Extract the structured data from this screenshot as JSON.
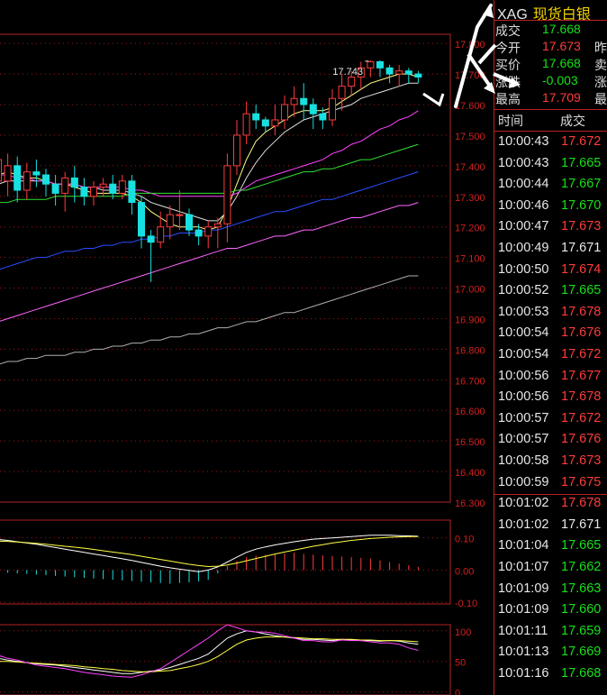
{
  "symbol": {
    "code": "XAG",
    "name": "现货白银"
  },
  "quote": [
    {
      "label": "成交",
      "value": "17.668",
      "color": "green",
      "extra": ""
    },
    {
      "label": "今开",
      "value": "17.673",
      "color": "red",
      "extra": "昨"
    },
    {
      "label": "买价",
      "value": "17.668",
      "color": "green",
      "extra": "卖"
    },
    {
      "label": "涨跌",
      "value": "-0.003",
      "color": "green",
      "extra": "涨"
    },
    {
      "label": "最高",
      "value": "17.709",
      "color": "red",
      "extra": "最"
    }
  ],
  "ticks_header": {
    "time": "时间",
    "price": "成交"
  },
  "ticks": [
    {
      "time": "10:00:43",
      "price": "17.672",
      "color": "red"
    },
    {
      "time": "10:00:43",
      "price": "17.665",
      "color": "green"
    },
    {
      "time": "10:00:44",
      "price": "17.667",
      "color": "green"
    },
    {
      "time": "10:00:46",
      "price": "17.670",
      "color": "green"
    },
    {
      "time": "10:00:47",
      "price": "17.673",
      "color": "red"
    },
    {
      "time": "10:00:49",
      "price": "17.671",
      "color": "white"
    },
    {
      "time": "10:00:50",
      "price": "17.674",
      "color": "red"
    },
    {
      "time": "10:00:52",
      "price": "17.665",
      "color": "green"
    },
    {
      "time": "10:00:53",
      "price": "17.678",
      "color": "red"
    },
    {
      "time": "10:00:54",
      "price": "17.676",
      "color": "red"
    },
    {
      "time": "10:00:54",
      "price": "17.672",
      "color": "red"
    },
    {
      "time": "10:00:56",
      "price": "17.677",
      "color": "red"
    },
    {
      "time": "10:00:56",
      "price": "17.678",
      "color": "red"
    },
    {
      "time": "10:00:57",
      "price": "17.672",
      "color": "red"
    },
    {
      "time": "10:00:57",
      "price": "17.676",
      "color": "red"
    },
    {
      "time": "10:00:58",
      "price": "17.673",
      "color": "red"
    },
    {
      "time": "10:00:59",
      "price": "17.675",
      "color": "red"
    },
    {
      "time": "10:01:02",
      "price": "17.678",
      "color": "red"
    },
    {
      "time": "10:01:02",
      "price": "17.671",
      "color": "white"
    },
    {
      "time": "10:01:04",
      "price": "17.665",
      "color": "green"
    },
    {
      "time": "10:01:07",
      "price": "17.662",
      "color": "green"
    },
    {
      "time": "10:01:09",
      "price": "17.663",
      "color": "green"
    },
    {
      "time": "10:01:09",
      "price": "17.660",
      "color": "green"
    },
    {
      "time": "10:01:11",
      "price": "17.659",
      "color": "green"
    },
    {
      "time": "10:01:13",
      "price": "17.669",
      "color": "green"
    },
    {
      "time": "10:01:16",
      "price": "17.668",
      "color": "green"
    }
  ],
  "colors": {
    "up": "#ff3b3b",
    "down": "#18e0e0",
    "grid": "#a01818",
    "border": "#b22222"
  },
  "chart_data": [
    {
      "type": "candlestick",
      "title": "",
      "ylim": [
        16.3,
        17.83
      ],
      "y_ticks": [
        "16.300",
        "16.400",
        "16.500",
        "16.600",
        "16.700",
        "16.800",
        "16.900",
        "17.000",
        "17.100",
        "17.200",
        "17.300",
        "17.400",
        "17.500",
        "17.600",
        "17.700",
        "17.800"
      ],
      "peak_label": "17.743",
      "candles": [
        [
          17.35,
          17.42,
          17.3,
          17.46
        ],
        [
          17.35,
          17.4,
          17.3,
          17.44
        ],
        [
          17.4,
          17.32,
          17.28,
          17.43
        ],
        [
          17.32,
          17.38,
          17.29,
          17.41
        ],
        [
          17.38,
          17.37,
          17.33,
          17.42
        ],
        [
          17.37,
          17.34,
          17.3,
          17.39
        ],
        [
          17.34,
          17.31,
          17.27,
          17.37
        ],
        [
          17.31,
          17.36,
          17.25,
          17.38
        ],
        [
          17.36,
          17.33,
          17.28,
          17.4
        ],
        [
          17.33,
          17.3,
          17.27,
          17.36
        ],
        [
          17.3,
          17.33,
          17.27,
          17.35
        ],
        [
          17.33,
          17.34,
          17.3,
          17.36
        ],
        [
          17.34,
          17.31,
          17.29,
          17.37
        ],
        [
          17.31,
          17.35,
          17.29,
          17.37
        ],
        [
          17.35,
          17.28,
          17.24,
          17.37
        ],
        [
          17.28,
          17.17,
          17.13,
          17.3
        ],
        [
          17.17,
          17.15,
          17.02,
          17.19
        ],
        [
          17.15,
          17.2,
          17.13,
          17.25
        ],
        [
          17.2,
          17.24,
          17.16,
          17.27
        ],
        [
          17.24,
          17.24,
          17.19,
          17.32
        ],
        [
          17.24,
          17.19,
          17.17,
          17.26
        ],
        [
          17.19,
          17.17,
          17.14,
          17.21
        ],
        [
          17.17,
          17.2,
          17.13,
          17.22
        ],
        [
          17.2,
          17.21,
          17.13,
          17.23
        ],
        [
          17.21,
          17.4,
          17.15,
          17.44
        ],
        [
          17.4,
          17.5,
          17.37,
          17.55
        ],
        [
          17.5,
          17.57,
          17.47,
          17.61
        ],
        [
          17.57,
          17.55,
          17.52,
          17.6
        ],
        [
          17.55,
          17.53,
          17.51,
          17.56
        ],
        [
          17.53,
          17.55,
          17.5,
          17.6
        ],
        [
          17.55,
          17.6,
          17.52,
          17.63
        ],
        [
          17.6,
          17.62,
          17.56,
          17.66
        ],
        [
          17.62,
          17.6,
          17.55,
          17.67
        ],
        [
          17.6,
          17.57,
          17.52,
          17.62
        ],
        [
          17.57,
          17.55,
          17.52,
          17.59
        ],
        [
          17.55,
          17.62,
          17.53,
          17.65
        ],
        [
          17.62,
          17.66,
          17.58,
          17.7
        ],
        [
          17.66,
          17.69,
          17.63,
          17.71
        ],
        [
          17.69,
          17.72,
          17.65,
          17.74
        ],
        [
          17.72,
          17.74,
          17.69,
          17.745
        ],
        [
          17.74,
          17.72,
          17.69,
          17.745
        ],
        [
          17.72,
          17.7,
          17.67,
          17.73
        ],
        [
          17.7,
          17.71,
          17.66,
          17.73
        ],
        [
          17.71,
          17.7,
          17.67,
          17.72
        ],
        [
          17.7,
          17.69,
          17.67,
          17.71
        ]
      ],
      "ma_series": [
        {
          "color": "#ffff88",
          "values": [
            17.37,
            17.38,
            17.37,
            17.36,
            17.36,
            17.35,
            17.34,
            17.34,
            17.33,
            17.32,
            17.31,
            17.31,
            17.31,
            17.31,
            17.3,
            17.28,
            17.25,
            17.23,
            17.21,
            17.2,
            17.2,
            17.2,
            17.19,
            17.2,
            17.26,
            17.34,
            17.42,
            17.48,
            17.51,
            17.53,
            17.55,
            17.57,
            17.58,
            17.58,
            17.58,
            17.59,
            17.61,
            17.63,
            17.65,
            17.67,
            17.68,
            17.69,
            17.7,
            17.7,
            17.69
          ]
        },
        {
          "color": "#e0e0e0",
          "values": [
            17.34,
            17.35,
            17.35,
            17.35,
            17.35,
            17.35,
            17.34,
            17.34,
            17.34,
            17.33,
            17.33,
            17.32,
            17.32,
            17.32,
            17.31,
            17.3,
            17.28,
            17.27,
            17.26,
            17.25,
            17.24,
            17.23,
            17.22,
            17.22,
            17.25,
            17.3,
            17.36,
            17.41,
            17.45,
            17.48,
            17.51,
            17.53,
            17.55,
            17.56,
            17.57,
            17.58,
            17.59,
            17.6,
            17.62,
            17.63,
            17.64,
            17.65,
            17.66,
            17.67,
            17.67
          ]
        },
        {
          "color": "#ff44ff",
          "values": [
            17.37,
            17.37,
            17.36,
            17.36,
            17.35,
            17.35,
            17.34,
            17.34,
            17.34,
            17.33,
            17.33,
            17.33,
            17.33,
            17.33,
            17.32,
            17.32,
            17.31,
            17.3,
            17.3,
            17.3,
            17.3,
            17.3,
            17.3,
            17.3,
            17.3,
            17.31,
            17.33,
            17.35,
            17.36,
            17.37,
            17.38,
            17.39,
            17.4,
            17.41,
            17.42,
            17.44,
            17.45,
            17.47,
            17.48,
            17.5,
            17.52,
            17.53,
            17.55,
            17.56,
            17.58
          ]
        },
        {
          "color": "#30e030",
          "values": [
            17.28,
            17.28,
            17.29,
            17.29,
            17.29,
            17.29,
            17.3,
            17.3,
            17.3,
            17.3,
            17.3,
            17.3,
            17.3,
            17.3,
            17.31,
            17.31,
            17.31,
            17.31,
            17.31,
            17.31,
            17.31,
            17.31,
            17.31,
            17.31,
            17.31,
            17.32,
            17.32,
            17.33,
            17.34,
            17.35,
            17.36,
            17.37,
            17.38,
            17.38,
            17.39,
            17.39,
            17.4,
            17.41,
            17.42,
            17.42,
            17.43,
            17.44,
            17.45,
            17.46,
            17.47
          ]
        },
        {
          "color": "#2a4dff",
          "values": [
            17.06,
            17.07,
            17.08,
            17.09,
            17.1,
            17.1,
            17.11,
            17.12,
            17.12,
            17.13,
            17.13,
            17.14,
            17.14,
            17.15,
            17.15,
            17.16,
            17.16,
            17.17,
            17.17,
            17.18,
            17.18,
            17.18,
            17.19,
            17.19,
            17.2,
            17.21,
            17.22,
            17.23,
            17.24,
            17.25,
            17.25,
            17.26,
            17.27,
            17.28,
            17.29,
            17.29,
            17.3,
            17.31,
            17.32,
            17.33,
            17.34,
            17.35,
            17.36,
            17.37,
            17.38
          ]
        },
        {
          "color": "#ff66ff",
          "values": [
            16.89,
            16.9,
            16.91,
            16.92,
            16.93,
            16.94,
            16.95,
            16.96,
            16.97,
            16.98,
            16.99,
            17.0,
            17.01,
            17.02,
            17.03,
            17.04,
            17.05,
            17.06,
            17.07,
            17.08,
            17.09,
            17.1,
            17.11,
            17.12,
            17.13,
            17.13,
            17.14,
            17.15,
            17.16,
            17.17,
            17.17,
            17.18,
            17.19,
            17.19,
            17.2,
            17.21,
            17.22,
            17.23,
            17.23,
            17.24,
            17.25,
            17.26,
            17.27,
            17.27,
            17.28
          ]
        },
        {
          "color": "#b0b0b0",
          "values": [
            16.75,
            16.76,
            16.76,
            16.77,
            16.77,
            16.78,
            16.78,
            16.78,
            16.79,
            16.79,
            16.8,
            16.8,
            16.81,
            16.81,
            16.82,
            16.82,
            16.83,
            16.83,
            16.84,
            16.84,
            16.85,
            16.85,
            16.86,
            16.87,
            16.87,
            16.88,
            16.89,
            16.89,
            16.9,
            16.91,
            16.92,
            16.92,
            16.93,
            16.94,
            16.95,
            16.96,
            16.97,
            16.98,
            16.99,
            17.0,
            17.01,
            17.02,
            17.03,
            17.04,
            17.04
          ]
        }
      ]
    },
    {
      "type": "macd",
      "y_ticks": [
        "0.10",
        "0.00",
        "-0.10"
      ],
      "ylim": [
        -0.105,
        0.155
      ],
      "dif": [
        0.095,
        0.092,
        0.088,
        0.084,
        0.08,
        0.075,
        0.07,
        0.065,
        0.06,
        0.055,
        0.05,
        0.045,
        0.04,
        0.035,
        0.03,
        0.024,
        0.018,
        0.012,
        0.007,
        0.003,
        -0.001,
        -0.005,
        0.0,
        0.01,
        0.025,
        0.04,
        0.055,
        0.065,
        0.072,
        0.078,
        0.083,
        0.088,
        0.092,
        0.096,
        0.098,
        0.1,
        0.102,
        0.104,
        0.106,
        0.108,
        0.108,
        0.108,
        0.107,
        0.106,
        0.105
      ],
      "dea": [
        0.09,
        0.089,
        0.087,
        0.085,
        0.083,
        0.08,
        0.077,
        0.074,
        0.071,
        0.068,
        0.064,
        0.06,
        0.056,
        0.052,
        0.048,
        0.043,
        0.038,
        0.033,
        0.028,
        0.023,
        0.018,
        0.014,
        0.011,
        0.012,
        0.016,
        0.022,
        0.029,
        0.036,
        0.043,
        0.05,
        0.056,
        0.062,
        0.068,
        0.074,
        0.079,
        0.084,
        0.088,
        0.092,
        0.095,
        0.098,
        0.1,
        0.102,
        0.103,
        0.104,
        0.104
      ],
      "hist": [
        -0.005,
        -0.008,
        -0.01,
        -0.012,
        -0.014,
        -0.016,
        -0.018,
        -0.02,
        -0.022,
        -0.024,
        -0.026,
        -0.028,
        -0.03,
        -0.032,
        -0.034,
        -0.036,
        -0.038,
        -0.04,
        -0.042,
        -0.04,
        -0.038,
        -0.035,
        -0.03,
        -0.01,
        0.012,
        0.028,
        0.04,
        0.045,
        0.048,
        0.05,
        0.052,
        0.054,
        0.05,
        0.048,
        0.046,
        0.044,
        0.042,
        0.04,
        0.038,
        0.036,
        0.03,
        0.025,
        0.02,
        0.015,
        0.01
      ]
    },
    {
      "type": "kdj",
      "y_ticks": [
        "100",
        "50",
        "0"
      ],
      "ylim": [
        -5,
        110
      ],
      "k": [
        55,
        52,
        50,
        48,
        46,
        45,
        44,
        42,
        40,
        38,
        36,
        34,
        32,
        30,
        30,
        32,
        34,
        36,
        40,
        45,
        50,
        55,
        62,
        75,
        88,
        95,
        100,
        98,
        95,
        92,
        90,
        88,
        86,
        86,
        85,
        84,
        86,
        85,
        84,
        84,
        83,
        84,
        83,
        80,
        78
      ],
      "d": [
        50,
        50,
        49,
        48,
        47,
        46,
        45,
        44,
        43,
        41,
        40,
        38,
        37,
        35,
        34,
        33,
        33,
        34,
        35,
        38,
        41,
        45,
        50,
        58,
        68,
        78,
        85,
        88,
        90,
        90,
        90,
        89,
        88,
        87,
        87,
        86,
        86,
        86,
        85,
        85,
        84,
        84,
        84,
        83,
        82
      ],
      "j": [
        60,
        55,
        52,
        48,
        44,
        42,
        40,
        38,
        35,
        32,
        30,
        28,
        26,
        25,
        24,
        28,
        33,
        38,
        48,
        58,
        68,
        78,
        88,
        100,
        110,
        105,
        100,
        98,
        98,
        96,
        92,
        88,
        84,
        84,
        82,
        82,
        85,
        84,
        84,
        82,
        80,
        80,
        78,
        72,
        68
      ]
    }
  ]
}
